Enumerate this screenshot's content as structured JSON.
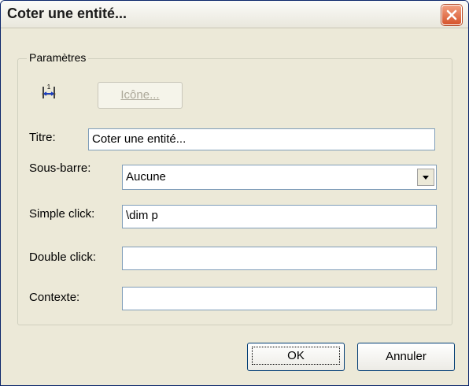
{
  "window": {
    "title": "Coter une entité..."
  },
  "group": {
    "legend": "Paramètres"
  },
  "icon_button": {
    "label": "Icône..."
  },
  "fields": {
    "titre": {
      "label": "Titre:",
      "value": "Coter une entité..."
    },
    "sousbarre": {
      "label": "Sous-barre:",
      "value": "Aucune"
    },
    "simple": {
      "label": "Simple click:",
      "value": "\\dim p"
    },
    "double": {
      "label": "Double click:",
      "value": ""
    },
    "contexte": {
      "label": "Contexte:",
      "value": ""
    }
  },
  "buttons": {
    "ok": "OK",
    "cancel": "Annuler"
  },
  "icons": {
    "close": "close-icon",
    "entity": "dimension-icon"
  }
}
